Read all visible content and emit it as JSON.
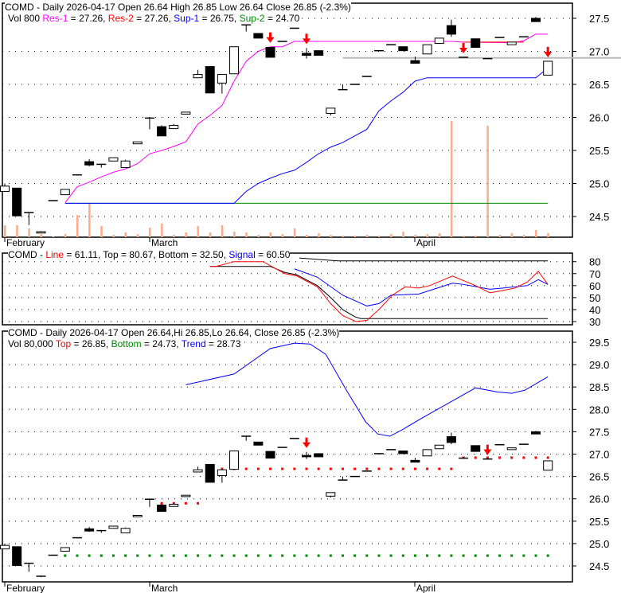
{
  "top_panel": {
    "title": "COMD - Daily 2026-04-17 Open 26.64  High 26.85  Low 26.64  Close 26.85 (-2.3%)",
    "vol_label": "Vol 800",
    "res1_label": "Res-1",
    "res1_value": " = 27.26, ",
    "res2_label": "Res-2",
    "res2_value": " = 27.26, ",
    "sup1_label": "Sup-1",
    "sup1_value": " = 26.75, ",
    "sup2_label": "Sup-2",
    "sup2_value": " = 24.70",
    "y_ticks": [
      "27.5",
      "27.0",
      "26.5",
      "26.0",
      "25.5",
      "25.0",
      "24.5"
    ],
    "x_labels": [
      "February",
      "March",
      "April"
    ]
  },
  "middle_panel": {
    "title_prefix": "COMD - ",
    "line_label": "Line",
    "line_value": " = 61.11, Top = 80.67, Bottom = 32.50, ",
    "signal_label": "Signal",
    "signal_value": " = 60.50",
    "y_ticks": [
      "80",
      "70",
      "60",
      "50",
      "40",
      "30"
    ]
  },
  "bottom_panel": {
    "title": "COMD - Daily 2026-04-17 Open 26.64,Hi 26.85,Lo 26.64, Close 26.85 (-2.3%)",
    "vol_label": "Vol 80,000 ",
    "top_label": "Top",
    "top_value": " = 26.85, ",
    "bottom_label": "Bottom",
    "bottom_value": " = 24.73, ",
    "trend_label": "Trend",
    "trend_value": " = 28.73",
    "y_ticks": [
      "29.5",
      "29.0",
      "28.5",
      "28.0",
      "27.5",
      "27.0",
      "26.5",
      "26.0",
      "25.5",
      "25.0",
      "24.5"
    ],
    "x_labels": [
      "February",
      "March",
      "April"
    ]
  },
  "colors": {
    "res1": "#ff00ff",
    "res2": "#ff0000",
    "sup1": "#0000ff",
    "sup2": "#008800",
    "volume": "#ffaa88",
    "arrow": "#ff0000",
    "grey_line": "#bbbbbb"
  },
  "chart_data": {
    "type": "candlestick",
    "month_label_index": [
      0,
      12,
      34
    ],
    "ohlc": [
      [
        24.88,
        25.0,
        24.88,
        24.96
      ],
      [
        24.93,
        24.93,
        24.51,
        24.51
      ],
      [
        24.56,
        24.56,
        24.37,
        24.56
      ],
      [
        24.25,
        24.28,
        24.25,
        24.27
      ],
      [
        24.74,
        24.74,
        24.74,
        24.74
      ],
      [
        24.83,
        24.91,
        24.83,
        24.91
      ],
      [
        25.13,
        25.13,
        25.13,
        25.13
      ],
      [
        25.33,
        25.37,
        25.26,
        25.28
      ],
      [
        25.29,
        25.29,
        25.24,
        25.28
      ],
      [
        25.34,
        25.39,
        25.34,
        25.39
      ],
      [
        25.24,
        25.36,
        25.24,
        25.34
      ],
      [
        25.6,
        25.63,
        25.6,
        25.63
      ],
      [
        25.99,
        26.0,
        25.82,
        25.98
      ],
      [
        25.86,
        25.88,
        25.72,
        25.72
      ],
      [
        25.83,
        25.9,
        25.83,
        25.88
      ],
      [
        26.05,
        26.08,
        26.05,
        26.08
      ],
      [
        26.6,
        26.72,
        26.6,
        26.65
      ],
      [
        26.77,
        26.77,
        26.37,
        26.37
      ],
      [
        26.52,
        26.65,
        26.36,
        26.65
      ],
      [
        26.66,
        27.07,
        26.66,
        27.07
      ],
      [
        27.4,
        27.4,
        27.3,
        27.4
      ],
      [
        27.27,
        27.27,
        27.2,
        27.2
      ],
      [
        27.06,
        27.07,
        26.91,
        26.91
      ],
      [
        27.15,
        27.15,
        27.15,
        27.15
      ],
      [
        27.35,
        27.35,
        27.35,
        27.35
      ],
      [
        26.97,
        27.05,
        26.89,
        26.94
      ],
      [
        27.01,
        27.01,
        26.94,
        26.94
      ],
      [
        26.06,
        26.14,
        26.03,
        26.14
      ],
      [
        26.42,
        26.5,
        26.42,
        26.42
      ],
      [
        26.5,
        26.5,
        26.5,
        26.5
      ],
      [
        26.62,
        26.62,
        26.62,
        26.62
      ],
      [
        27.01,
        27.01,
        27.01,
        27.01
      ],
      [
        27.1,
        27.1,
        27.1,
        27.1
      ],
      [
        27.07,
        27.07,
        27.01,
        27.01
      ],
      [
        26.86,
        26.92,
        26.82,
        26.82
      ],
      [
        26.96,
        27.1,
        26.96,
        27.1
      ],
      [
        27.12,
        27.2,
        27.12,
        27.2
      ],
      [
        27.39,
        27.48,
        27.22,
        27.26
      ],
      [
        26.91,
        26.91,
        26.91,
        26.91
      ],
      [
        27.19,
        27.19,
        27.06,
        27.06
      ],
      [
        26.89,
        26.89,
        26.89,
        26.89
      ],
      [
        27.21,
        27.21,
        27.21,
        27.21
      ],
      [
        27.1,
        27.14,
        27.1,
        27.14
      ],
      [
        27.22,
        27.22,
        27.22,
        27.22
      ],
      [
        27.5,
        27.52,
        27.45,
        27.45
      ],
      [
        26.64,
        26.85,
        26.64,
        26.85
      ]
    ],
    "volume": [
      500,
      500,
      370,
      130,
      30,
      130,
      930,
      1400,
      470,
      100,
      200,
      130,
      400,
      570,
      100,
      200,
      470,
      200,
      500,
      230,
      200,
      100,
      200,
      130,
      370,
      100,
      170,
      100,
      70,
      70,
      100,
      70,
      130,
      230,
      100,
      130,
      170,
      4870,
      70,
      70,
      4670,
      100,
      170,
      100,
      300,
      170
    ],
    "top_ylim": [
      24.26,
      27.72
    ],
    "res1": [
      [
        5,
        24.71
      ],
      [
        6,
        24.95
      ],
      [
        7,
        25.02
      ],
      [
        8,
        25.1
      ],
      [
        9,
        25.17
      ],
      [
        10,
        25.22
      ],
      [
        11,
        25.3
      ],
      [
        12,
        25.45
      ],
      [
        13,
        25.5
      ],
      [
        14,
        25.56
      ],
      [
        15,
        25.63
      ],
      [
        16,
        25.9
      ],
      [
        17,
        26.03
      ],
      [
        18,
        26.18
      ],
      [
        19,
        26.55
      ],
      [
        20,
        26.85
      ],
      [
        21,
        27.0
      ],
      [
        22,
        27.07
      ],
      [
        23,
        27.07
      ],
      [
        24,
        27.15
      ],
      [
        37,
        27.15
      ],
      [
        38,
        27.14
      ],
      [
        42,
        27.13
      ],
      [
        43,
        27.16
      ],
      [
        44,
        27.26
      ],
      [
        45,
        27.26
      ]
    ],
    "res2": [
      [
        38,
        27.14
      ],
      [
        43,
        27.14
      ]
    ],
    "sup1": [
      [
        5,
        24.7
      ],
      [
        19,
        24.7
      ],
      [
        20,
        24.88
      ],
      [
        21,
        25.0
      ],
      [
        22,
        25.08
      ],
      [
        23,
        25.15
      ],
      [
        24,
        25.2
      ],
      [
        25,
        25.32
      ],
      [
        26,
        25.45
      ],
      [
        27,
        25.55
      ],
      [
        28,
        25.62
      ],
      [
        29,
        25.72
      ],
      [
        30,
        25.82
      ],
      [
        31,
        26.1
      ],
      [
        32,
        26.25
      ],
      [
        33,
        26.38
      ],
      [
        34,
        26.55
      ],
      [
        35,
        26.6
      ],
      [
        44,
        26.6
      ],
      [
        45,
        26.75
      ]
    ],
    "sup2": [
      [
        5,
        24.7
      ],
      [
        45,
        24.7
      ]
    ],
    "grey_line": {
      "from_index": 28,
      "value": 26.9
    },
    "top_arrows": [
      22,
      25,
      38,
      45
    ],
    "osc_ylim": [
      28,
      84
    ],
    "osc_line": [
      [
        17,
        76
      ],
      [
        17.5,
        76
      ],
      [
        19,
        80
      ],
      [
        21.4,
        80
      ],
      [
        23.2,
        70
      ],
      [
        24.2,
        68
      ],
      [
        25.9,
        59
      ],
      [
        27,
        45
      ],
      [
        28,
        35
      ],
      [
        29.1,
        30
      ],
      [
        30,
        31
      ],
      [
        31,
        40
      ],
      [
        32.1,
        52
      ],
      [
        33.2,
        59
      ],
      [
        34.3,
        58
      ],
      [
        35.2,
        60
      ],
      [
        37.1,
        68
      ],
      [
        39,
        60
      ],
      [
        40.2,
        54
      ],
      [
        41.3,
        56
      ],
      [
        42.3,
        58
      ],
      [
        43.3,
        63
      ],
      [
        44.2,
        72
      ],
      [
        45,
        61
      ]
    ],
    "osc_signal": [
      [
        24,
        74
      ],
      [
        25.9,
        67
      ],
      [
        28,
        52
      ],
      [
        30,
        43
      ],
      [
        31,
        45
      ],
      [
        32,
        52
      ],
      [
        34.3,
        53
      ],
      [
        37.1,
        62
      ],
      [
        38,
        61
      ],
      [
        40.2,
        57
      ],
      [
        41.3,
        58
      ],
      [
        43.3,
        60
      ],
      [
        44.2,
        65
      ],
      [
        45,
        61
      ]
    ],
    "osc_top": [
      [
        24.4,
        83
      ],
      [
        27.6,
        80.67
      ],
      [
        45,
        80.67
      ]
    ],
    "osc_bottom": [
      [
        17,
        76
      ],
      [
        22,
        76
      ],
      [
        23.2,
        71
      ],
      [
        24.2,
        69
      ],
      [
        25.9,
        60
      ],
      [
        27,
        50
      ],
      [
        28,
        40
      ],
      [
        29,
        34
      ],
      [
        29.5,
        32.5
      ],
      [
        45,
        32.5
      ]
    ],
    "bottom_ylim": [
      24.15,
      29.75
    ],
    "trend": [
      [
        15,
        28.55
      ],
      [
        19,
        28.79
      ],
      [
        22,
        29.36
      ],
      [
        24,
        29.48
      ],
      [
        25.3,
        29.46
      ],
      [
        26.6,
        29.23
      ],
      [
        28.3,
        28.43
      ],
      [
        29.9,
        27.72
      ],
      [
        30.9,
        27.45
      ],
      [
        31.9,
        27.4
      ],
      [
        32.9,
        27.54
      ],
      [
        34.6,
        27.81
      ],
      [
        36.9,
        28.16
      ],
      [
        39,
        28.48
      ],
      [
        40.8,
        28.39
      ],
      [
        42,
        28.36
      ],
      [
        43.1,
        28.43
      ],
      [
        45,
        28.73
      ]
    ],
    "top_dots": [
      [
        13,
        16,
        25.9
      ],
      [
        17,
        37,
        26.67
      ],
      [
        38,
        45,
        26.92
      ]
    ],
    "bottom_dots": [
      [
        5,
        45,
        24.73
      ]
    ],
    "bottom_arrows": [
      25,
      40
    ]
  }
}
